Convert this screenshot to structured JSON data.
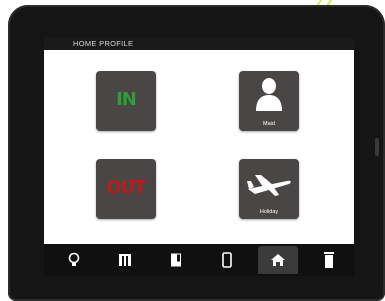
{
  "header": {
    "title": "HOME PROFILE"
  },
  "tiles": [
    {
      "label": "IN",
      "icon": "in-text-icon",
      "color": "#2e9e3a"
    },
    {
      "label": "Maid",
      "icon": "person-icon"
    },
    {
      "label": "OUT",
      "icon": "out-text-icon",
      "color": "#b41e1e"
    },
    {
      "label": "Holiday",
      "icon": "airplane-icon"
    }
  ],
  "toolbar": {
    "icons": [
      "lightbulb-icon",
      "window-icon",
      "door-icon",
      "phone-icon",
      "home-icon",
      "trash-icon"
    ],
    "active": "home-icon"
  }
}
